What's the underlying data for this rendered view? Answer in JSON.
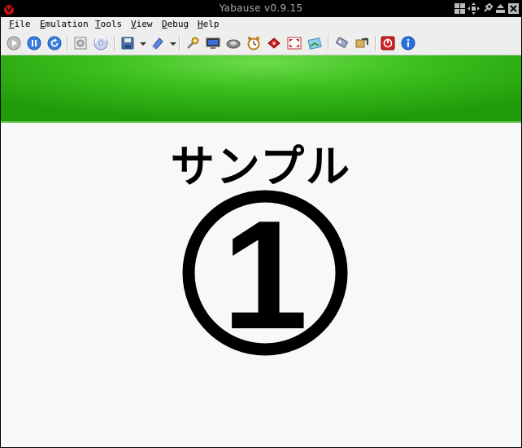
{
  "window": {
    "title": "Yabause v0.9.15",
    "controls": [
      "tile-icon",
      "move-icon",
      "pin-icon",
      "minimize-icon",
      "close-icon"
    ]
  },
  "menubar": {
    "items": [
      {
        "label": "File"
      },
      {
        "label": "Emulation"
      },
      {
        "label": "Tools"
      },
      {
        "label": "View"
      },
      {
        "label": "Debug"
      },
      {
        "label": "Help"
      }
    ]
  },
  "toolbar": {
    "buttons": [
      "run-icon",
      "pause-icon",
      "reset-icon",
      "open-iso-icon",
      "open-cd-icon",
      "save-state-icon",
      "load-state-icon",
      "settings-icon",
      "vdp-icon",
      "cdrom-icon",
      "clock-icon",
      "cheats-icon",
      "fullscreen-icon",
      "screenshot-icon",
      "memory-icon",
      "transfer-icon",
      "quit-icon",
      "about-icon"
    ]
  },
  "screen": {
    "text": "サンプル",
    "number": "1",
    "banner_color": "#2fae12"
  }
}
